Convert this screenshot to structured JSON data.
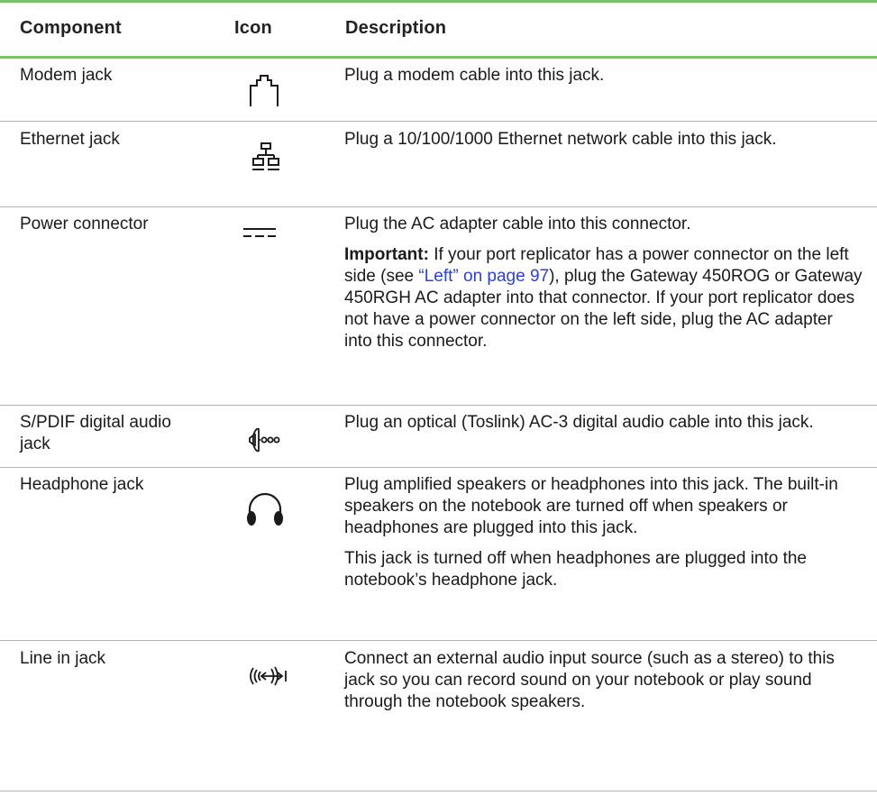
{
  "headers": {
    "component": "Component",
    "icon": "Icon",
    "description": "Description"
  },
  "rows": [
    {
      "component": "Modem jack",
      "icon": "modem-jack-icon",
      "desc": [
        "Plug a modem cable into this jack."
      ]
    },
    {
      "component": "Ethernet jack",
      "icon": "ethernet-jack-icon",
      "desc": [
        "Plug a 10/100/1000 Ethernet network cable into this jack."
      ]
    },
    {
      "component": "Power connector",
      "icon": "dc-power-icon",
      "desc": [
        "Plug the AC adapter cable into this connector."
      ],
      "important": {
        "label": "Important:",
        "before": " If your port replicator has a power connector on the left side (see ",
        "link": "“Left” on page 97",
        "after": "), plug the Gateway 450ROG or Gateway 450RGH AC adapter into that connector. If your port replicator does not have a power connector on the left side, plug the AC adapter into this connector."
      }
    },
    {
      "component": "S/PDIF digital audio jack",
      "icon": "spdif-icon",
      "desc": [
        "Plug an optical (Toslink) AC-3 digital audio cable into this jack."
      ]
    },
    {
      "component": "Headphone jack",
      "icon": "headphone-icon",
      "desc": [
        "Plug amplified speakers or headphones into this jack. The built-in speakers on the notebook are turned off when speakers or headphones are plugged into this jack.",
        "This jack is turned off when headphones are plugged into the notebook’s headphone jack."
      ]
    },
    {
      "component": "Line in jack",
      "icon": "line-in-icon",
      "desc": [
        "Connect an external audio input source (such as a stereo) to this jack so you can record sound on your notebook or play sound through the notebook speakers."
      ]
    }
  ],
  "colors": {
    "rule_green": "#7ec06a",
    "rule_gray": "#b4b4b4",
    "link": "#2a3fe0"
  }
}
